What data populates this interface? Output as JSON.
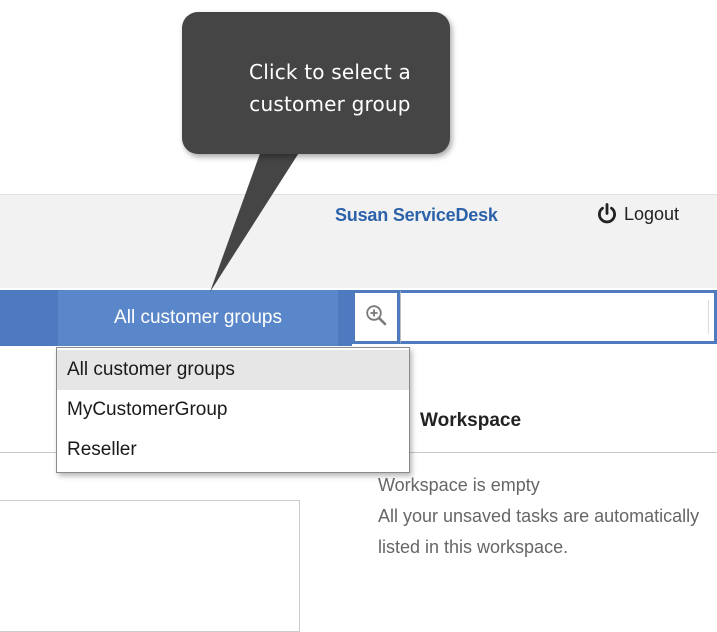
{
  "tooltip": {
    "text": "Click to select a\ncustomer group"
  },
  "header": {
    "user_name": "Susan ServiceDesk",
    "logout_label": "Logout",
    "logout_icon": "power-icon"
  },
  "nav": {
    "customer_group_selected": "All customer groups",
    "search_icon": "zoom-in-icon",
    "search_value": ""
  },
  "dropdown": {
    "items": [
      {
        "label": "All customer groups",
        "selected": true
      },
      {
        "label": "MyCustomerGroup",
        "selected": false
      },
      {
        "label": "Reseller",
        "selected": false
      }
    ]
  },
  "workspace": {
    "title": "Workspace",
    "empty_line1": "Workspace is empty",
    "empty_line2": "All your unsaved tasks are automatically listed in this workspace."
  },
  "colors": {
    "nav_blue": "#4e7bc0",
    "selector_blue": "#5a87c9",
    "user_link": "#2b62a9",
    "tooltip_bg": "#454545"
  }
}
